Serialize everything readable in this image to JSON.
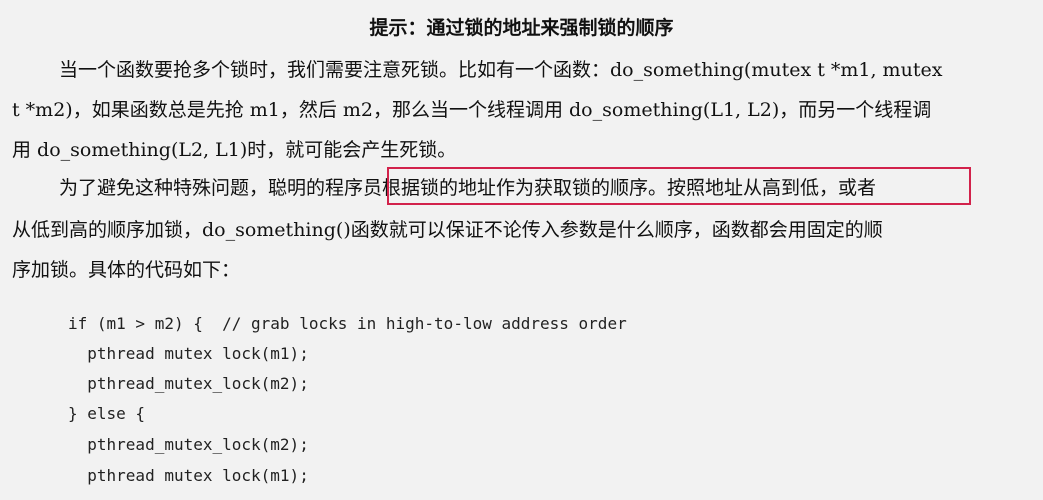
{
  "title": "提示：通过锁的地址来强制锁的顺序",
  "paragraph1": {
    "line1": "当一个函数要抢多个锁时，我们需要注意死锁。比如有一个函数：do_something(mutex t *m1, mutex",
    "line2": "t *m2)，如果函数总是先抢 m1，然后 m2，那么当一个线程调用 do_something(L1, L2)，而另一个线程调",
    "line3": "用 do_something(L2, L1)时，就可能会产生死锁。"
  },
  "paragraph2": {
    "line1_before": "为了避免这种特殊问题，聪明的",
    "line1_highlighted": "程序员根据锁的地址作为获取锁的顺序。按照地址从高到低",
    "line1_after": "，或者",
    "line2": "从低到高的顺序加锁，do_something()函数就可以保证不论传入参数是什么顺序，函数都会用固定的顺",
    "line3": "序加锁。具体的代码如下："
  },
  "code": {
    "line1": "if (m1 > m2) {  // grab locks in high-to-low address order",
    "line2": "  pthread mutex lock(m1);",
    "line3": "  pthread_mutex_lock(m2);",
    "line4": "} else {",
    "line5": "  pthread_mutex_lock(m2);",
    "line6": "  pthread mutex lock(m1);"
  },
  "colors": {
    "highlight_border": "#d2224b",
    "background": "#f2f2f2"
  }
}
